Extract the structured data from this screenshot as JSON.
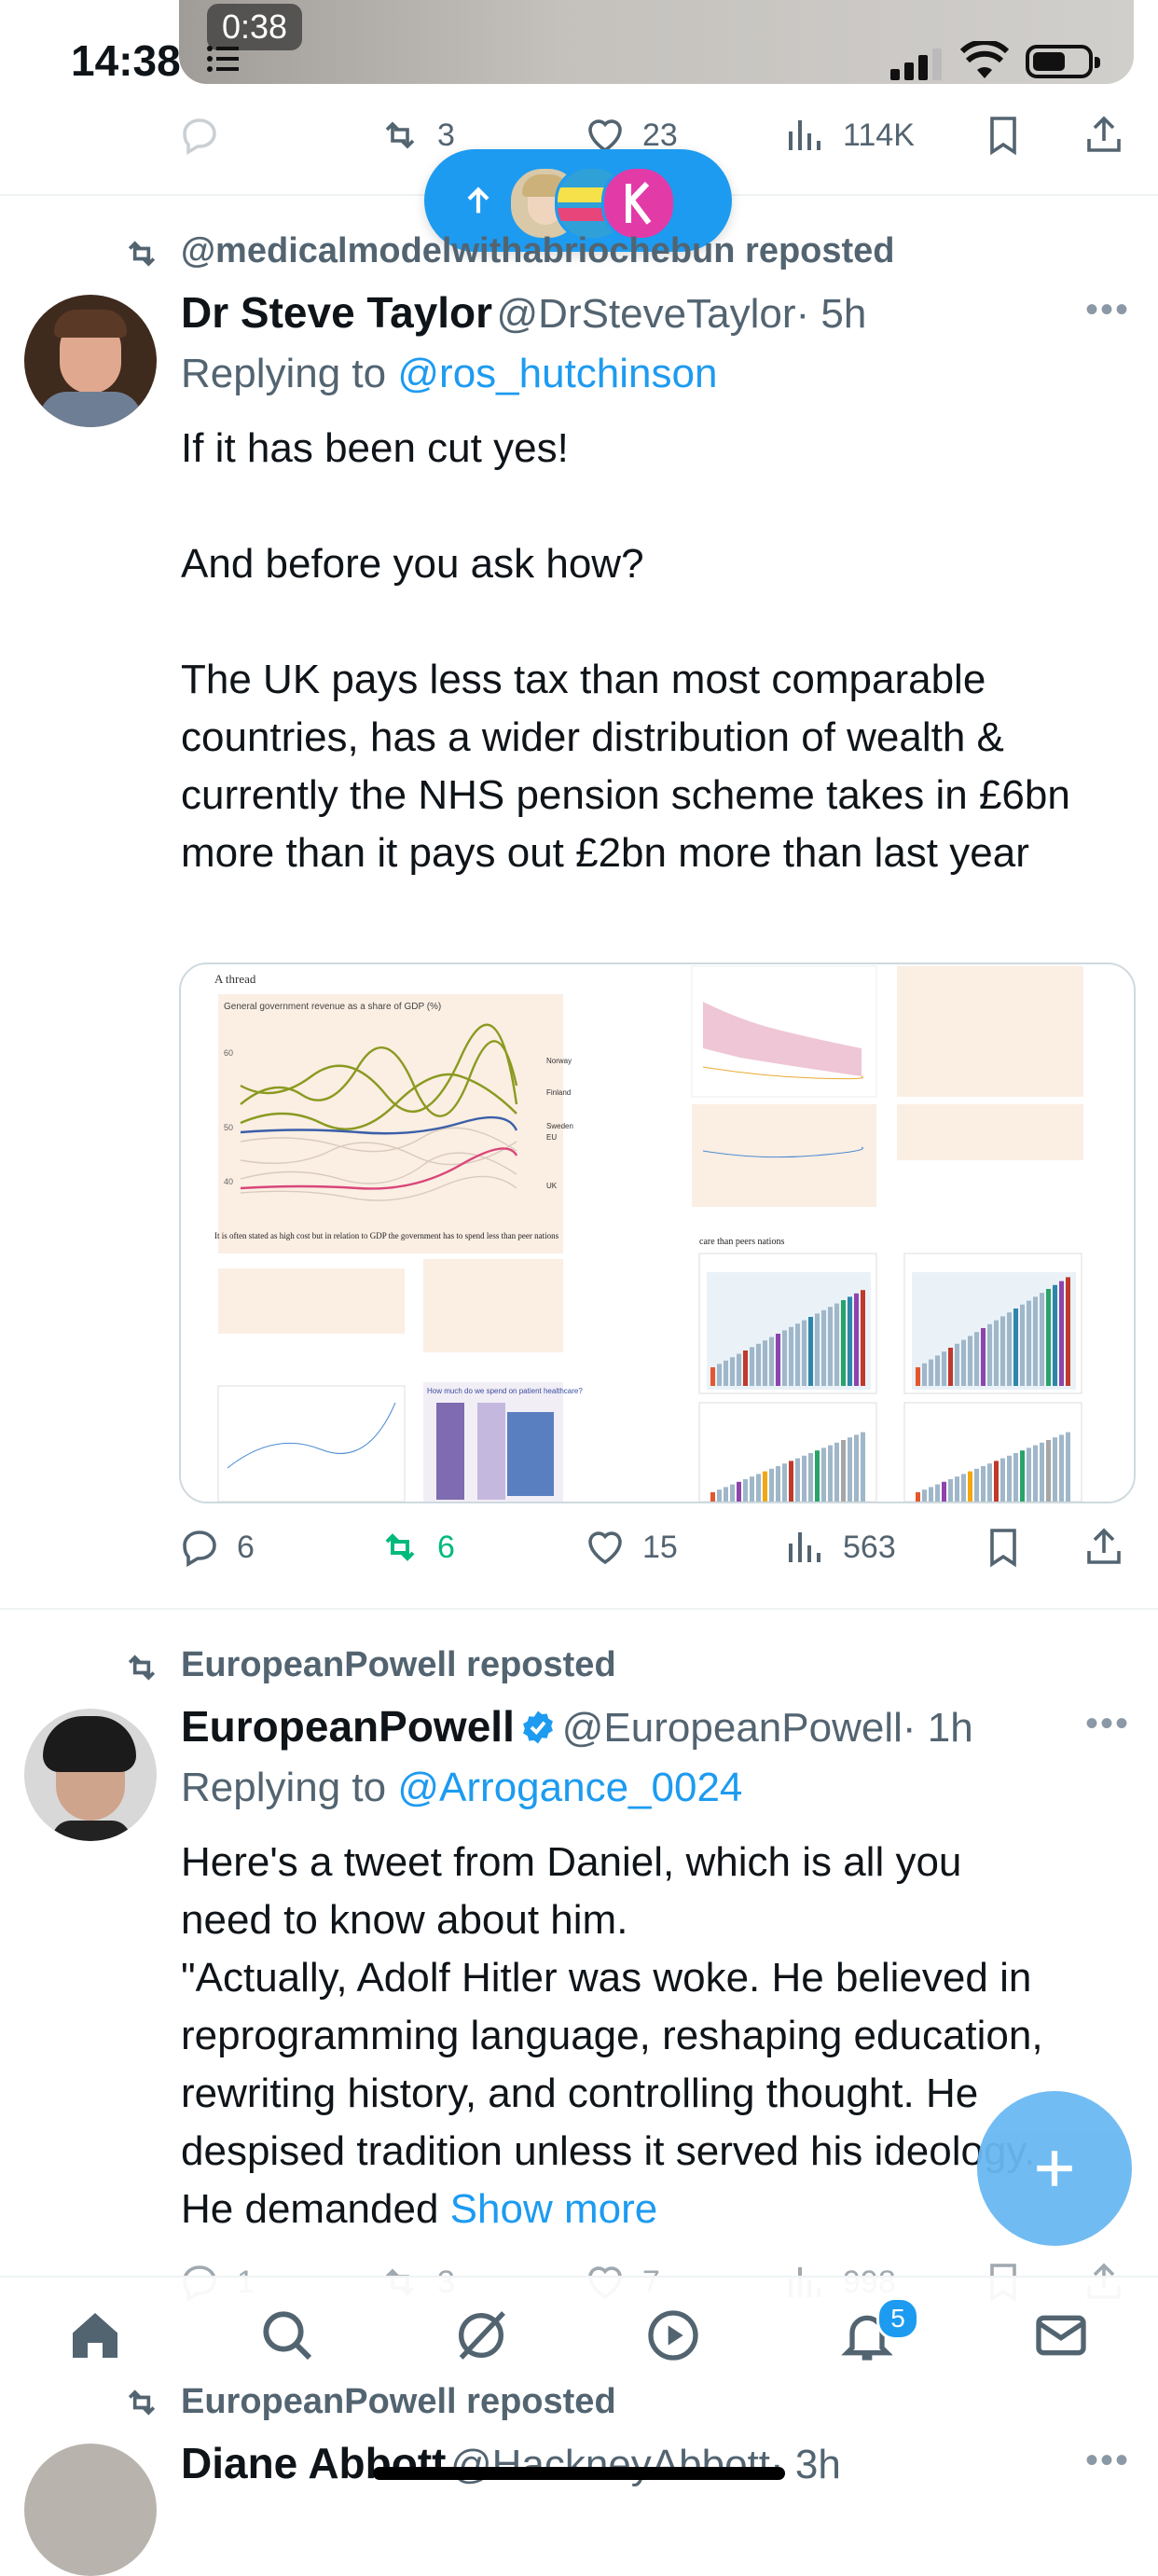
{
  "status_bar": {
    "time": "14:38",
    "media_duration": "0:38"
  },
  "top_actions": {
    "reply": "",
    "reposts": "3",
    "likes": "23",
    "views": "114K"
  },
  "tweet1": {
    "repost_by": "@medicalmodelwithabriochebun reposted",
    "name": "Dr Steve Taylor",
    "handle": "@DrSteveTaylor",
    "time": "· 5h",
    "reply_prefix": "Replying to",
    "reply_to": "@ros_hutchinson",
    "paragraphs": [
      "If it has been cut yes!",
      "",
      "And before you ask how?",
      "",
      "The UK pays less tax than most comparable countries, has a wider distribution of wealth & currently the NHS pension scheme takes in £6bn more than it pays out £2bn more than last year"
    ],
    "image": {
      "thread_label": "A thread",
      "chart_title": "General government revenue as a share of GDP (%)",
      "legend": [
        "Norway",
        "Finland",
        "Sweden",
        "EU",
        "UK"
      ],
      "yticks": [
        "60",
        "50",
        "40"
      ],
      "caption1": "It is often stated as high cost but in relation to GDP the government has to spend less than peer nations",
      "caption2": "care than peers nations",
      "mini_title": "How much do we spend on patient healthcare?"
    },
    "actions": {
      "replies": "6",
      "reposts": "6",
      "likes": "15",
      "views": "563"
    }
  },
  "tweet2": {
    "repost_by": "EuropeanPowell reposted",
    "name": "EuropeanPowell",
    "handle": "@EuropeanPowell",
    "time": "· 1h",
    "reply_prefix": "Replying to",
    "reply_to": "@Arrogance_0024",
    "lines": [
      "Here's a tweet from Daniel, which is all you",
      "need to know about him.",
      "\"Actually, Adolf Hitler was woke.  He believed in",
      "reprogramming language, reshaping education,",
      "rewriting history, and controlling thought. He",
      "despised tradition unless it served his ideology."
    ],
    "last_line": "He demanded",
    "show_more": "Show more",
    "actions": {
      "replies": "1",
      "reposts": "3",
      "likes": "7",
      "views": "998"
    }
  },
  "tweet3": {
    "repost_by": "EuropeanPowell reposted",
    "name": "Diane Abbott",
    "handle": "@HackneyAbbott",
    "time": "· 3h"
  },
  "tabbar": {
    "notification_count": "5"
  },
  "colors": {
    "accent": "#1d9bf0",
    "repost_green": "#00ba7c",
    "muted": "#536471"
  }
}
